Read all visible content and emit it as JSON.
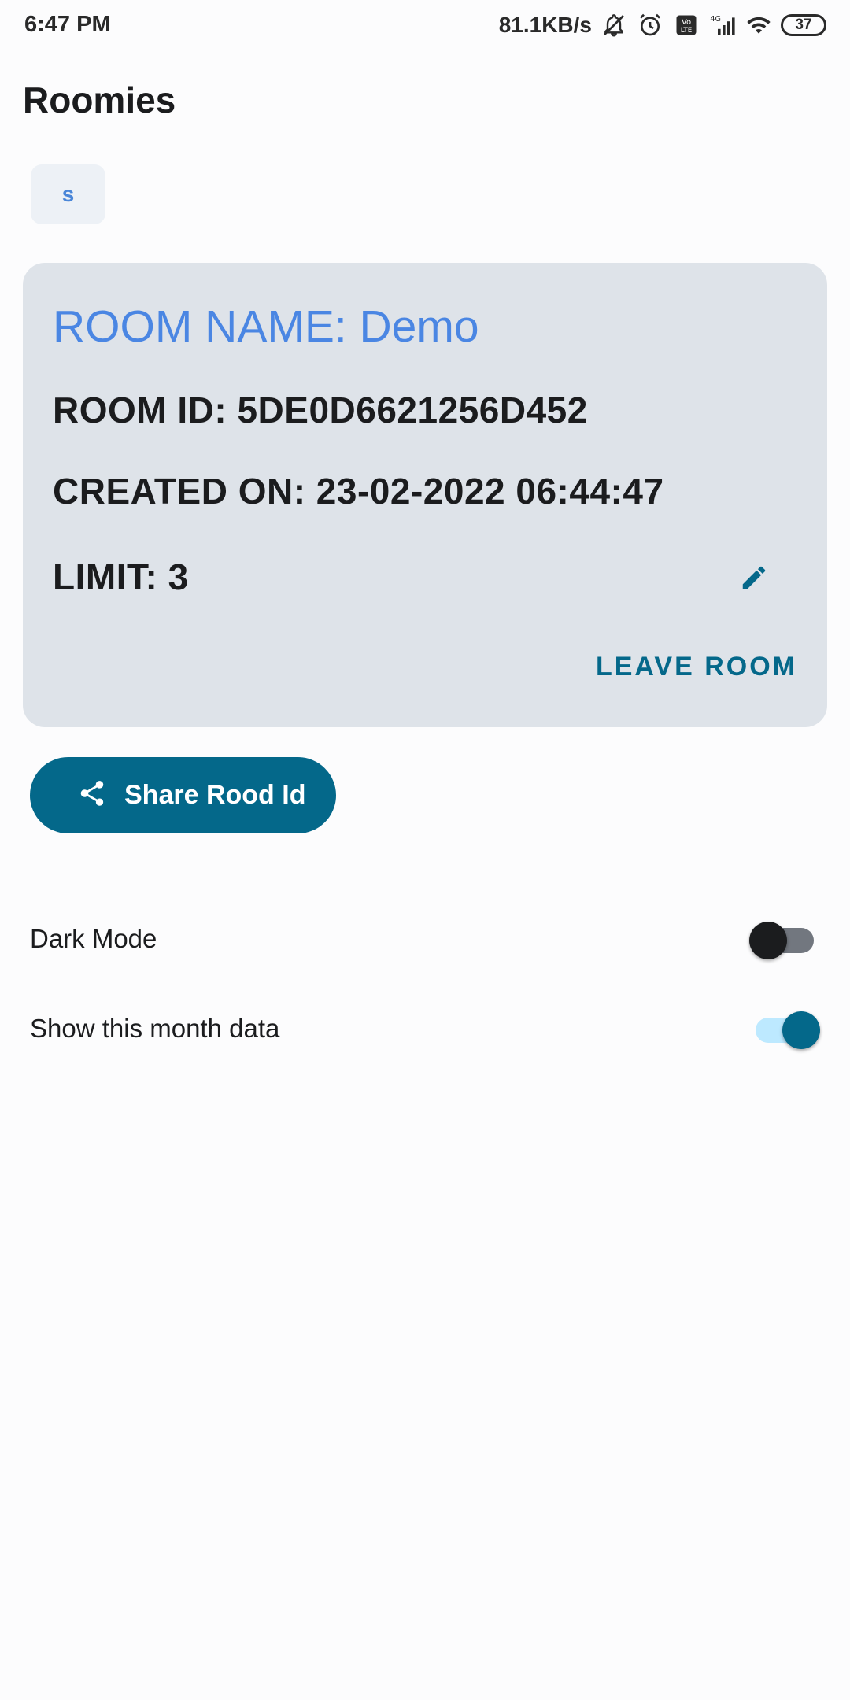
{
  "status_bar": {
    "time": "6:47 PM",
    "net_speed": "81.1KB/s",
    "battery": "37",
    "icons": [
      "mute-icon",
      "alarm-icon",
      "volte-icon",
      "signal-4g-icon",
      "wifi-icon",
      "battery-icon"
    ]
  },
  "app_bar": {
    "title": "Roomies"
  },
  "avatar": {
    "initial": "s"
  },
  "room": {
    "name": "ROOM NAME: Demo",
    "id": "ROOM ID: 5DE0D6621256D452",
    "created_on": "CREATED ON: 23-02-2022 06:44:47",
    "limit": "LIMIT: 3",
    "leave_label": "LEAVE ROOM"
  },
  "share": {
    "label": "Share Rood Id",
    "icon": "share-icon"
  },
  "settings": {
    "dark_mode": {
      "label": "Dark Mode",
      "enabled": false
    },
    "month_data": {
      "label": "Show this month data",
      "enabled": true
    }
  },
  "colors": {
    "primary": "#04688a",
    "room_name": "#4a86e3",
    "card_bg": "#dee3e9",
    "background": "#fcfcfd"
  }
}
